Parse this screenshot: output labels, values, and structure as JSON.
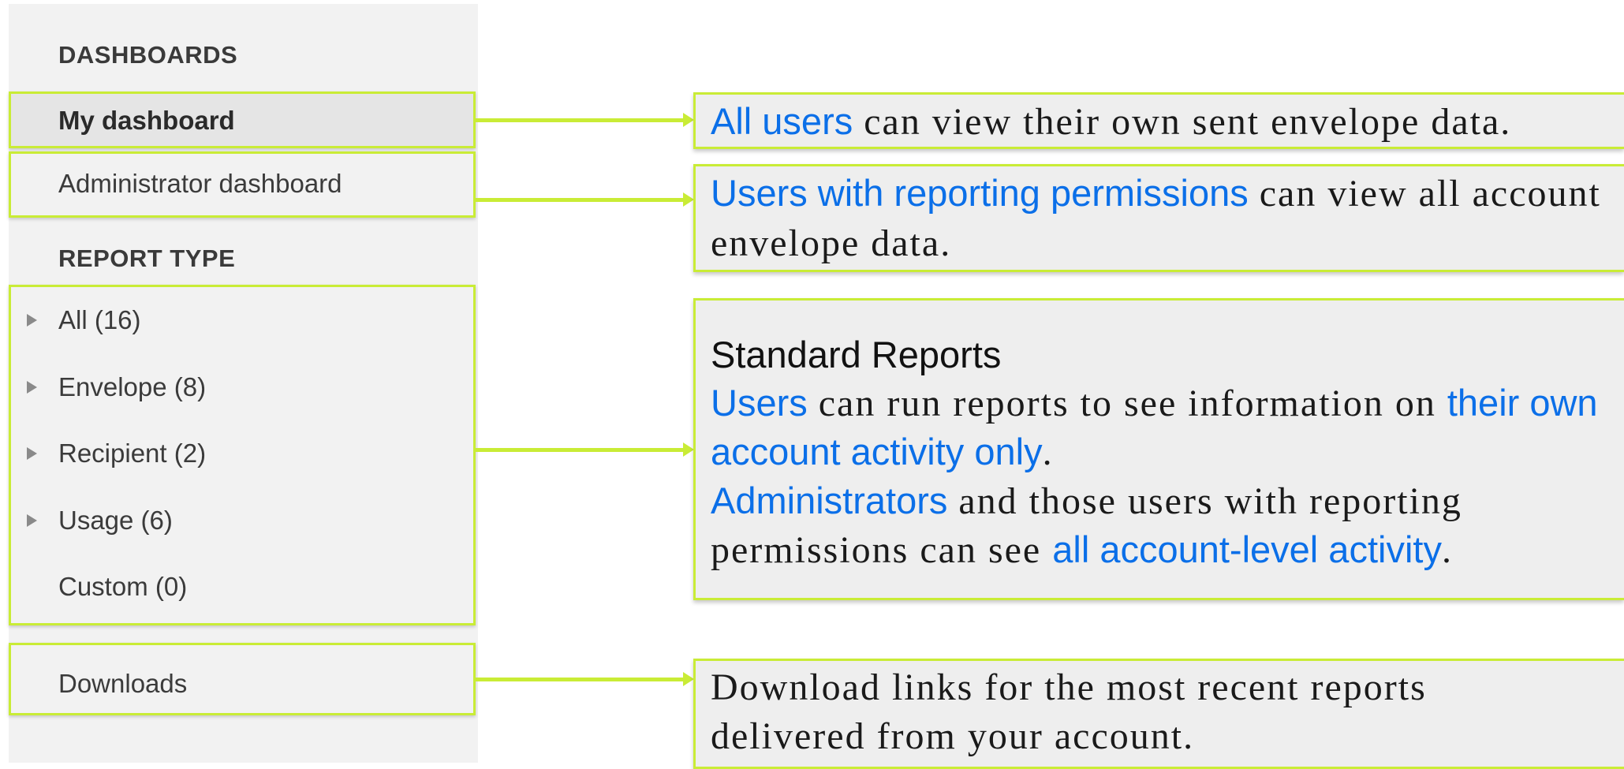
{
  "sidebar": {
    "dashboards_heading": "DASHBOARDS",
    "my_dashboard": "My dashboard",
    "admin_dashboard": "Administrator dashboard",
    "report_type_heading": "REPORT TYPE",
    "report_items": [
      {
        "label": "All (16)"
      },
      {
        "label": "Envelope (8)"
      },
      {
        "label": "Recipient (2)"
      },
      {
        "label": "Usage (6)"
      },
      {
        "label": "Custom (0)"
      }
    ],
    "downloads": "Downloads"
  },
  "callouts": {
    "my_dashboard": {
      "highlight": "All users",
      "text": " can view their own sent envelope data."
    },
    "admin_dashboard": {
      "highlight": "Users with reporting permissions",
      "text": " can view all account envelope data."
    },
    "standard_reports": {
      "heading": "Standard Reports",
      "p1_highlight": "Users",
      "p1_text": " can run reports to see information on ",
      "p1_highlight2": "their own account activity only",
      "p1_end": ".",
      "p2_highlight": "Administrators",
      "p2_text": " and those users with reporting permissions can see ",
      "p2_highlight2": "all account-level activity",
      "p2_end": "."
    },
    "downloads": {
      "text": "Download links for the most recent reports delivered from your account."
    }
  },
  "colors": {
    "accent_green": "#c9ec36",
    "highlight_blue": "#0b6fe8",
    "sidebar_bg": "#f2f2f2",
    "callout_bg": "#eeeeee"
  }
}
